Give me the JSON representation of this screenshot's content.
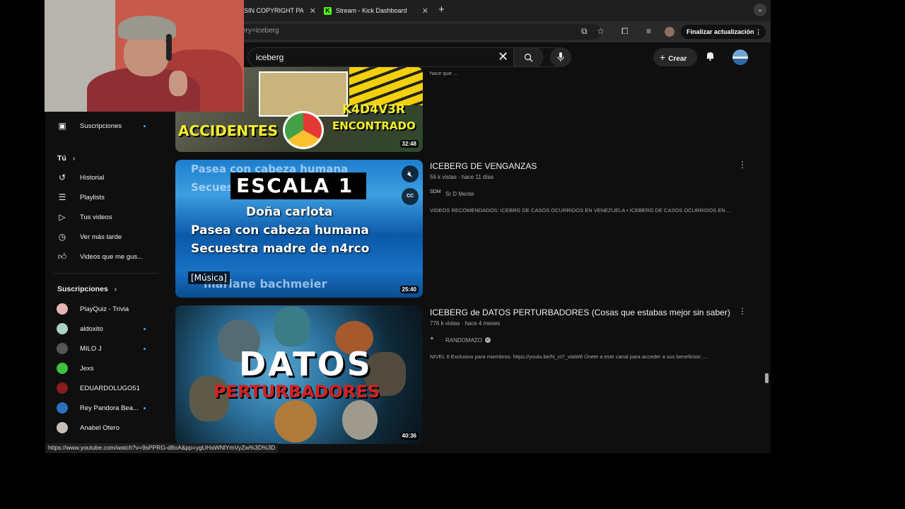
{
  "browser": {
    "tabs": [
      {
        "title": "SIN COPYRIGHT PA"
      },
      {
        "title": "Stream - Kick Dashboard"
      }
    ],
    "url": "ery=iceberg",
    "update_button": "Finalizar actualización",
    "status_url": "https://www.youtube.com/watch?v=9sPPRG-d8oA&pp=ygUHaWNlYmVyZw%3D%3D"
  },
  "youtube": {
    "search_query": "iceberg",
    "create_label": "Crear"
  },
  "sidebar": {
    "top": [
      {
        "label": "Suscripciones",
        "icon": "subscriptions-icon"
      }
    ],
    "you_heading": "Tú",
    "you_items": [
      {
        "label": "Historial",
        "icon": "history-icon"
      },
      {
        "label": "Playlists",
        "icon": "playlists-icon"
      },
      {
        "label": "Tus videos",
        "icon": "your-videos-icon"
      },
      {
        "label": "Ver más tarde",
        "icon": "watch-later-icon"
      },
      {
        "label": "Videos que me gus...",
        "icon": "thumbs-up-icon"
      }
    ],
    "subs_heading": "Suscripciones",
    "channels": [
      {
        "label": "PlayQuiz - Trivia",
        "color": "#e7b3b3",
        "new": false
      },
      {
        "label": "aldoxito",
        "color": "#a9d2c4",
        "new": true
      },
      {
        "label": "MILO J",
        "color": "#555555",
        "new": true
      },
      {
        "label": "Jexs",
        "color": "#3fbf3f",
        "new": false
      },
      {
        "label": "EDUARDOLUGO51",
        "color": "#8a1c1c",
        "new": false
      },
      {
        "label": "Rey Pandora Bea...",
        "color": "#2d6fbf",
        "new": true
      },
      {
        "label": "Anabel Otero",
        "color": "#c8bfb8",
        "new": false
      }
    ]
  },
  "results": [
    {
      "desc": "hace que ...",
      "duration": "32:48",
      "thumb_text": [
        "ACCIDENTES",
        "K4D4V3R",
        "ENCONTRADO"
      ]
    },
    {
      "title": "ICEBERG DE VENGANZAS",
      "meta": "56 k vistas · hace 11 días",
      "channel": "Sr D Mente",
      "desc": "VIDEOS RECOMENDADOS: ICEBRG DE CASOS OCURRIDOS EN VENEZUELA • ICEBERG DE CASOS OCURRIDOS EN ...",
      "duration": "25:40",
      "thumb_text": [
        "Pasea con cabeza humana",
        "Secuestra m",
        "ESCALA 1",
        "Doña carlota",
        "Pasea con cabeza humana",
        "Secuestra madre de n4rco",
        "[Música]",
        "mariane bachmeier"
      ]
    },
    {
      "title": "ICEBERG de DATOS PERTURBADORES (Cosas que estabas mejor sin saber)",
      "meta": "776 k vistas · hace 4 meses",
      "channel": "RANDOMAZO",
      "desc": "NIVEL 6 Exclusivo para miembros: https://youtu.be/N_ct7_vtaW8 Únete a este canal para acceder a sus beneficios: ...",
      "duration": "40:36",
      "thumb_text": [
        "DATOS",
        "PERTURBADORES"
      ]
    }
  ]
}
